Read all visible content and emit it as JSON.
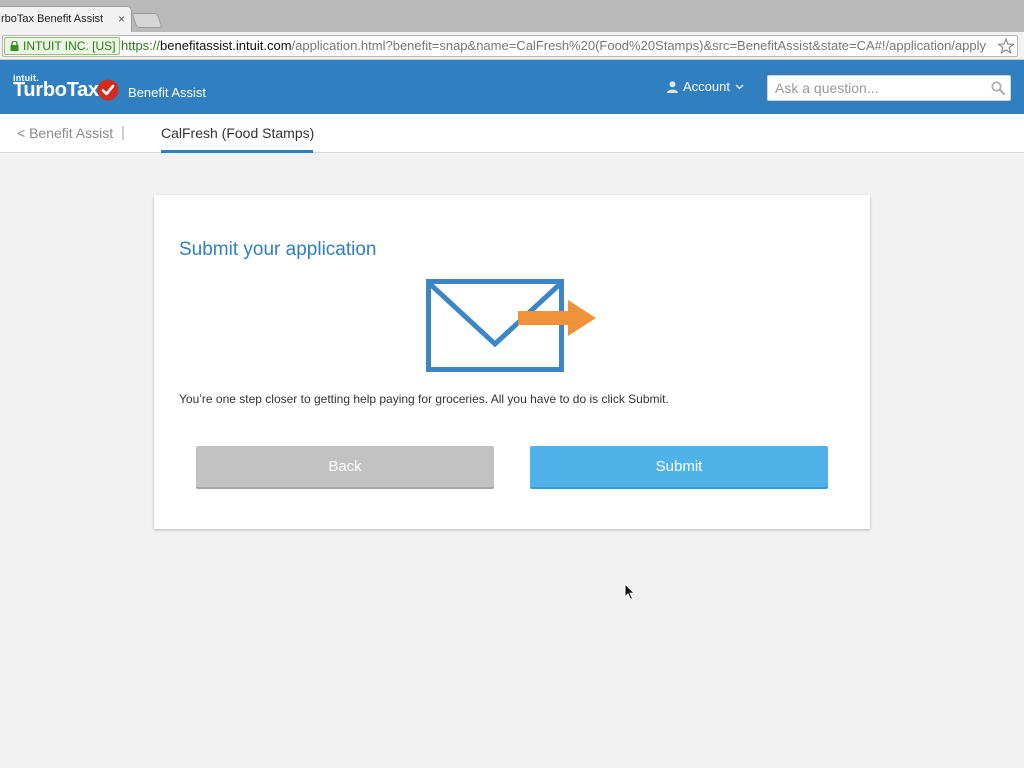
{
  "browser": {
    "tab_title": "rboTax Benefit Assist",
    "tab_close": "×",
    "ev_cert": "INTUIT INC. [US]",
    "url_scheme": "https://",
    "url_host": "benefitassist.intuit.com",
    "url_path": "/application.html?benefit=snap&name=CalFresh%20(Food%20Stamps)&src=BenefitAssist&state=CA#!/application/apply"
  },
  "header": {
    "brand_small": "intuit.",
    "brand": "TurboTax",
    "product": "Benefit Assist",
    "account_label": "Account",
    "search_placeholder": "Ask a question..."
  },
  "subnav": {
    "back_label": "< Benefit Assist",
    "separator": "|",
    "active_tab": "CalFresh (Food Stamps)"
  },
  "card": {
    "title": "Submit your application",
    "message": "You’re one step closer to getting help paying for groceries. All you have to do is click Submit.",
    "back_button": "Back",
    "submit_button": "Submit"
  },
  "colors": {
    "header_bg": "#2f7fc1",
    "submit_bg": "#4fb3ea",
    "back_bg": "#c2c2c2",
    "envelope": "#3d86c6",
    "arrow": "#f0923a",
    "logo_check": "#d52b1e"
  }
}
